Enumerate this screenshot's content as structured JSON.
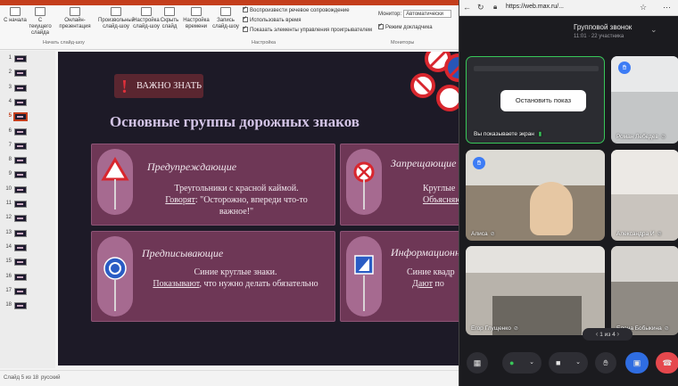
{
  "ribbon": {
    "buttons": [
      {
        "label": "С начала"
      },
      {
        "label": "С текущего слайда"
      },
      {
        "label": "Онлайн-презентация"
      },
      {
        "label": "Произвольный слайд-шоу"
      },
      {
        "label": "Настройка слайд-шоу"
      },
      {
        "label": "Скрыть слайд"
      },
      {
        "label": "Настройка времени"
      },
      {
        "label": "Запись слайд-шоу"
      }
    ],
    "group_start": "Начать слайд-шоу",
    "group_setup": "Настройка",
    "group_monitors": "Мониторы",
    "checks": [
      {
        "label": "Воспроизвести речевое сопровождение"
      },
      {
        "label": "Использовать время"
      },
      {
        "label": "Показать элементы управления проигрывателем"
      }
    ],
    "monitor_label": "Монитор:",
    "monitor_value": "Автоматически",
    "presenter_mode": "Режим докладчика"
  },
  "thumbnails": [
    "1",
    "2",
    "3",
    "4",
    "5",
    "6",
    "7",
    "8",
    "9",
    "10",
    "11",
    "12",
    "13",
    "14",
    "15",
    "16",
    "17",
    "18"
  ],
  "selected_slide": "5",
  "status": {
    "slide_of": "Слайд 5 из 18",
    "language": "русский"
  },
  "slide": {
    "badge": "ВАЖНО ЗНАТЬ",
    "title": "Основные группы дорожных знаков",
    "cards": [
      {
        "title": "Предупреждающие",
        "line1": "Треугольники с красной каймой.",
        "line2_u": "Говорят",
        "line2": ": \"Осторожно, впереди что-то",
        "line3": "важное!\""
      },
      {
        "title": "Запрещающие",
        "line1": "Круглые",
        "line2_u": "Объясняют",
        "line2": "",
        "line3": ""
      },
      {
        "title": "Предписывающие",
        "line1": "Синие круглые знаки.",
        "line2_u": "Показывают",
        "line2": ", что нужно делать обязательно",
        "line3": ""
      },
      {
        "title": "Информационные",
        "line1": "Синие квадр",
        "line2_u": "Дают",
        "line2": " по",
        "line3": ""
      }
    ]
  },
  "browser": {
    "url": "https://web.max.ru/..."
  },
  "call": {
    "title": "Групповой звонок",
    "meta": "11:01 · 22 участника",
    "stop_share": "Остановить показ",
    "self_label": "Вы показываете экран",
    "participants": [
      {
        "name": "Роман Лебедев"
      },
      {
        "name": "Алиса"
      },
      {
        "name": "Александра И"
      },
      {
        "name": "Егор Глущенко"
      },
      {
        "name": "Елена Бобыкина"
      }
    ],
    "pager": "1 из 4"
  },
  "icons": {
    "hand": "raised-hand-icon",
    "mic": "microphone-icon",
    "camera": "camera-icon",
    "end_call": "end-call-icon"
  },
  "colors": {
    "accent_ppt": "#c43e1c",
    "hand_blue": "#3d7cf5",
    "end_call": "#e5484d",
    "share_blue": "#2f6de1",
    "speaking_green": "#38c759"
  }
}
